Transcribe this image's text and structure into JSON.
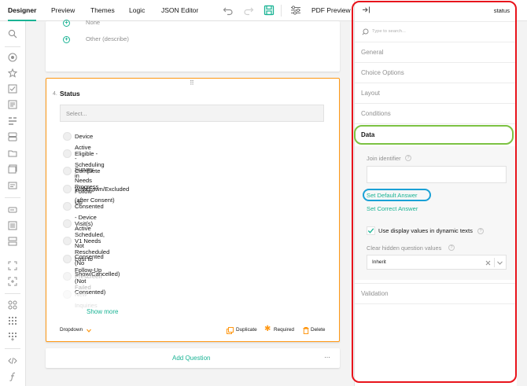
{
  "toolbar": {
    "tabs": [
      "Designer",
      "Preview",
      "Themes",
      "Logic",
      "JSON Editor"
    ],
    "pdf_preview": "PDF Preview"
  },
  "prev_question": {
    "choices": [
      "None",
      "Other (describe)"
    ]
  },
  "question": {
    "number": "4.",
    "title": "Status",
    "placeholder": "Select...",
    "choices": [
      "Device Active - Survey Needs Follow-Up",
      "Eligible - Scheduling in Progress",
      "Complete",
      "Withdrawn/Excluded (after Consent)",
      "Consented - Device Active",
      "Visit(s) Scheduled, Not Consented",
      "V1 Needs Rescheduled (No Show/Cancelled)",
      "Lost to Follow-Up (Not Consented)",
      "Prescreen Failed",
      "New Inquiries"
    ],
    "show_more": "Show more",
    "type_label": "Dropdown",
    "duplicate": "Duplicate",
    "required": "Required",
    "delete": "Delete"
  },
  "add_question": "Add Question",
  "more_dots": "···",
  "panel": {
    "object_name": "status",
    "search_placeholder": "Type to search...",
    "sections": [
      "General",
      "Choice Options",
      "Layout",
      "Conditions"
    ],
    "data_section": "Data",
    "join_identifier_label": "Join identifier",
    "set_default_answer": "Set Default Answer",
    "set_correct_answer": "Set Correct Answer",
    "use_display_values_label": "Use display values in dynamic texts",
    "clear_hidden_label": "Clear hidden question values",
    "clear_hidden_value": "Inherit",
    "validation_section": "Validation"
  },
  "colors": {
    "accent": "#19b394",
    "orange": "#ff9814",
    "highlight_red": "#e8141c",
    "highlight_green": "#7cc243",
    "highlight_blue": "#1aa1d6"
  }
}
